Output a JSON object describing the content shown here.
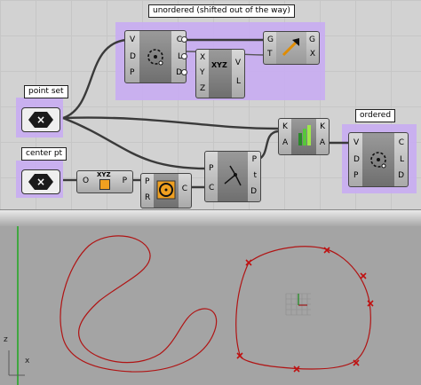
{
  "groups": {
    "unordered": "unordered (shifted out of the way)",
    "point_set": "point set",
    "center_pt": "center pt",
    "ordered": "ordered"
  },
  "components": {
    "closest_top": {
      "inputs": [
        "V",
        "D",
        "P"
      ],
      "outputs": [
        "C",
        "L",
        "D"
      ]
    },
    "vector_xyz": {
      "inputs": [
        "X",
        "Y",
        "Z"
      ],
      "outputs": [
        "V",
        "L"
      ],
      "icon_text": "XYZ"
    },
    "gradient": {
      "inputs": [
        "G",
        "T"
      ],
      "outputs": [
        "G",
        "X"
      ]
    },
    "point_xyz": {
      "inputs": [
        "O"
      ],
      "outputs": [
        "P"
      ],
      "icon_text": "XYZ"
    },
    "sort": {
      "inputs": [
        "K",
        "A"
      ],
      "outputs": [
        "K",
        "A"
      ]
    },
    "circle_comp": {
      "inputs": [
        "P",
        "R"
      ],
      "outputs": [
        "C"
      ]
    },
    "vector_comp": {
      "inputs": [
        "P",
        "C"
      ],
      "outputs": [
        "P",
        "t",
        "D"
      ]
    },
    "closest_right": {
      "inputs": [
        "V",
        "D",
        "P"
      ],
      "outputs": [
        "C",
        "L",
        "D"
      ]
    }
  },
  "params": {
    "point_set_icon": "×",
    "center_pt_icon": "×"
  },
  "viewport": {
    "axis_z": "z",
    "axis_x": "x"
  },
  "colors": {
    "group_fill": "#c8aef0",
    "curve": "#b01414",
    "marker": "#c01010",
    "viewport_bg": "#a4a4a4",
    "y_axis": "#1fa81f"
  }
}
